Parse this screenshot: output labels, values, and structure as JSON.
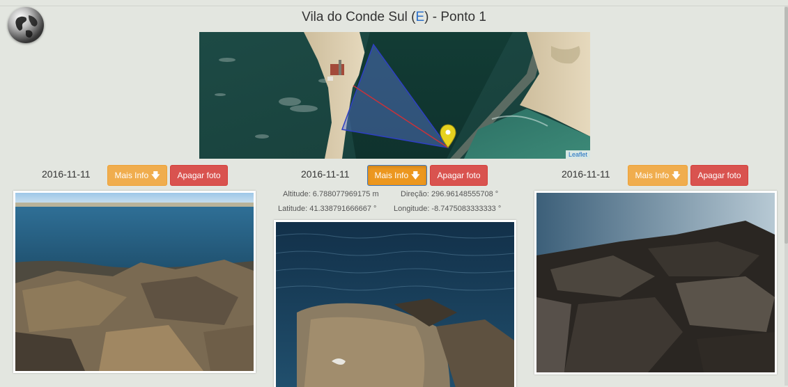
{
  "header": {
    "title_prefix": "Vila do Conde Sul (",
    "title_link": "E",
    "title_suffix": ") - Ponto 1",
    "globe_icon": "globe-icon"
  },
  "map": {
    "attribution": "Leaflet",
    "marker_icon": "map-pin-icon"
  },
  "photos": [
    {
      "date": "2016-11-11",
      "info_label": "Mais Info",
      "delete_label": "Apagar foto"
    },
    {
      "date": "2016-11-11",
      "info_label": "Mais Info",
      "delete_label": "Apagar foto",
      "altitude": "Altitude: 6.788077969175 m",
      "direction": "Direção: 296.96148555708 °",
      "latitude": "Latitude: 41.338791666667 °",
      "longitude": "Longitude: -8.7475083333333 °"
    },
    {
      "date": "2016-11-11",
      "info_label": "Mais Info",
      "delete_label": "Apagar foto"
    }
  ],
  "colors": {
    "info_button": "#f0ad4e",
    "delete_button": "#d9534f",
    "link": "#2a6ec9",
    "view_cone": "#3b5bd6"
  }
}
